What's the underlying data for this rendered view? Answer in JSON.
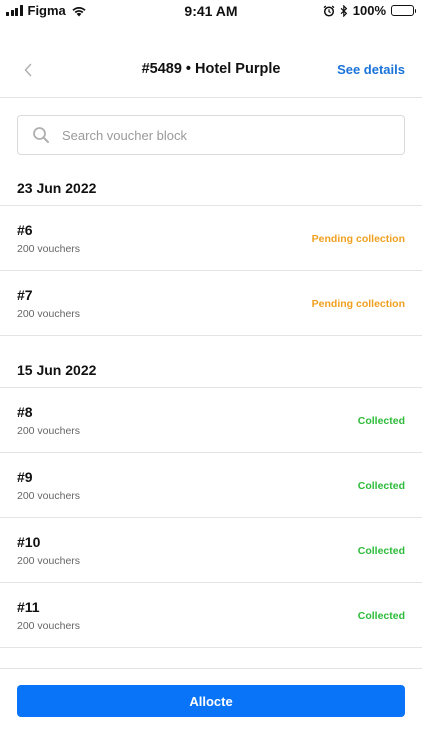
{
  "status_bar": {
    "carrier": "Figma",
    "time": "9:41 AM",
    "battery": "100%"
  },
  "nav": {
    "title": "#5489 • Hotel Purple",
    "action_label": "See details"
  },
  "search": {
    "placeholder": "Search voucher block",
    "value": ""
  },
  "sections": [
    {
      "date": "23 Jun 2022",
      "items": [
        {
          "id": "#6",
          "count": "200 vouchers",
          "status": "Pending collection"
        },
        {
          "id": "#7",
          "count": "200 vouchers",
          "status": "Pending collection"
        }
      ]
    },
    {
      "date": "15 Jun 2022",
      "items": [
        {
          "id": "#8",
          "count": "200 vouchers",
          "status": "Collected"
        },
        {
          "id": "#9",
          "count": "200 vouchers",
          "status": "Collected"
        },
        {
          "id": "#10",
          "count": "200 vouchers",
          "status": "Collected"
        },
        {
          "id": "#11",
          "count": "200 vouchers",
          "status": "Collected"
        }
      ]
    }
  ],
  "footer": {
    "button_label": "Allocte"
  },
  "colors": {
    "accent": "#0a74f8",
    "link": "#1a73d9",
    "pending": "#f0a020",
    "collected": "#2dbb3a"
  }
}
